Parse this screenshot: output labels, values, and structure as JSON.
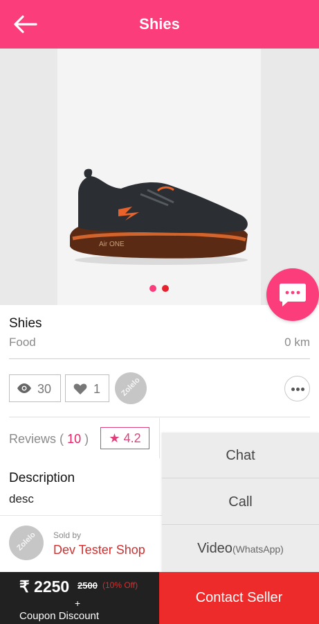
{
  "header": {
    "title": "Shies",
    "back_icon": "arrow-left-icon"
  },
  "gallery": {
    "image": "black-orange-sneaker",
    "slide_count": 2,
    "active_slide": 1
  },
  "chat_fab": {
    "icon": "chat-bubble-icon"
  },
  "product": {
    "name": "Shies",
    "category": "Food",
    "distance": "0 km"
  },
  "stats": {
    "views": "30",
    "likes": "1",
    "badge_text": "Zolelo"
  },
  "reviews": {
    "label": "Reviews",
    "open": "(",
    "count": "10",
    "close": ")",
    "rating_star": "★",
    "rating": "4.2"
  },
  "description": {
    "title": "Description",
    "text": "desc"
  },
  "seller": {
    "sold_by": "Sold by",
    "name": "Dev Tester Shop",
    "logo_text": "Zolelo"
  },
  "actions": {
    "chat": "Chat",
    "call": "Call",
    "video": "Video",
    "video_suffix": "(WhatsApp)"
  },
  "pricing": {
    "currency": "₹",
    "price": "2250",
    "original": "2500",
    "discount": "(10% Off)",
    "plus": "+",
    "coupon": "Coupon Discount"
  },
  "contact_button": "Contact Seller",
  "colors": {
    "primary": "#fb3d7b",
    "contact": "#ee2b2b",
    "price_bar": "#212121",
    "shop_name": "#d32f2f"
  }
}
